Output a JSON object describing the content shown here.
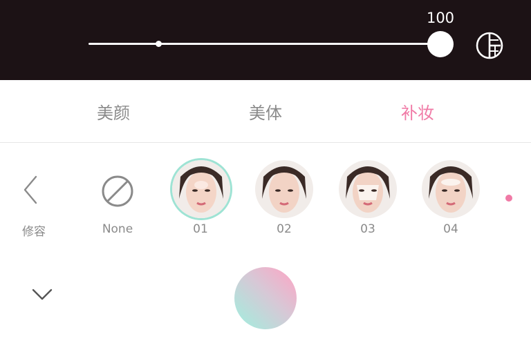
{
  "slider": {
    "value": "100",
    "fill_fraction": 1.0
  },
  "compare_icon": "contrast-compare-icon",
  "tabs": [
    {
      "label": "美颜",
      "active": false
    },
    {
      "label": "美体",
      "active": false
    },
    {
      "label": "补妆",
      "active": true
    }
  ],
  "colors": {
    "accent": "#f07aa6",
    "selected_ring": "#9ee3d4",
    "top_background": "#1c1215",
    "inactive_text": "#8a8a8a"
  },
  "makeup": {
    "back_label": "修容",
    "none_label": "None",
    "items": [
      {
        "label": "01",
        "selected": true
      },
      {
        "label": "02",
        "selected": false
      },
      {
        "label": "03",
        "selected": false
      },
      {
        "label": "04",
        "selected": false
      }
    ]
  },
  "icons": {
    "back": "chevron-left-icon",
    "none": "none-slash-icon",
    "collapse": "chevron-down-icon",
    "shutter": "shutter-button"
  }
}
